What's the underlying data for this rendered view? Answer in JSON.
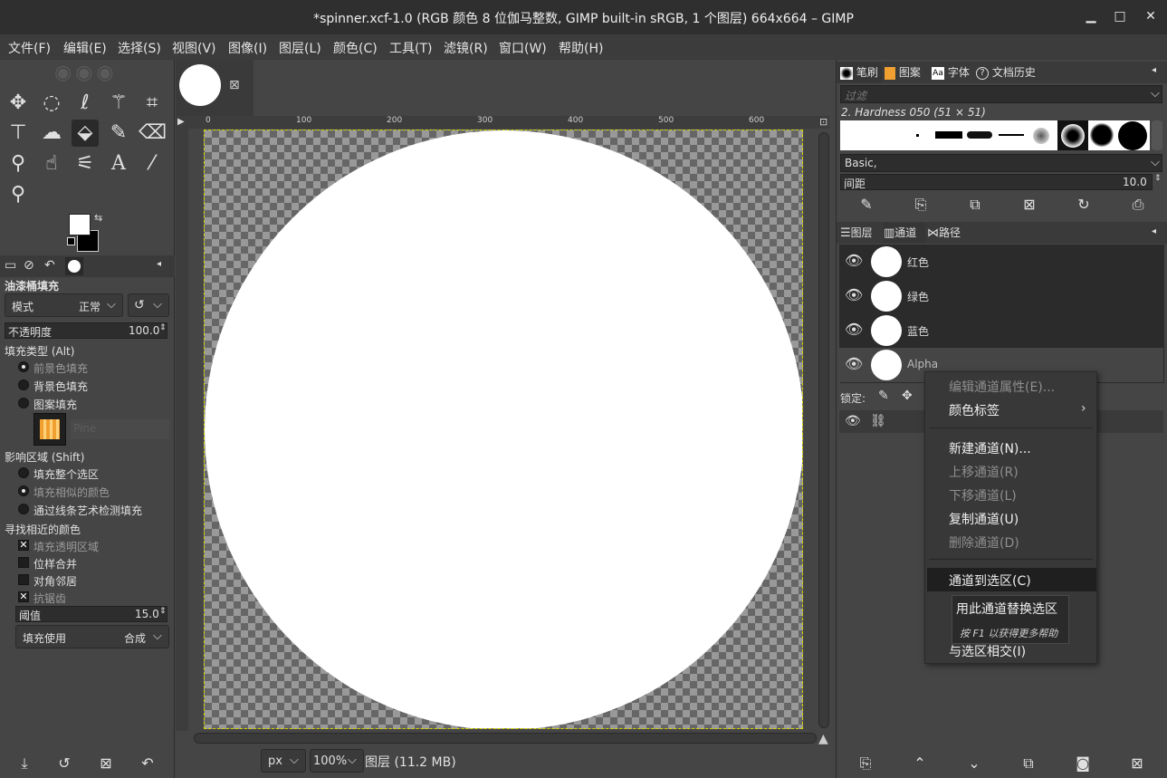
{
  "window": {
    "title": "*spinner.xcf-1.0 (RGB 颜色 8 位伽马整数, GIMP built-in sRGB, 1 个图层) 664x664 – GIMP"
  },
  "menubar": [
    "文件(F)",
    "编辑(E)",
    "选择(S)",
    "视图(V)",
    "图像(I)",
    "图层(L)",
    "颜色(C)",
    "工具(T)",
    "滤镜(R)",
    "窗口(W)",
    "帮助(H)"
  ],
  "tool_options": {
    "title": "油漆桶填充",
    "mode_label": "模式",
    "mode_value": "正常",
    "opacity_label": "不透明度",
    "opacity_value": "100.0",
    "fill_type_label": "填充类型 (Alt)",
    "fill_types": [
      "前景色填充",
      "背景色填充",
      "图案填充"
    ],
    "pattern_name": "Pine",
    "affected_area_label": "影响区域 (Shift)",
    "affected_areas": [
      "填充整个选区",
      "填充相似的颜色",
      "通过线条艺术检测填充"
    ],
    "find_similar_label": "寻找相近的颜色",
    "checks": [
      "填充透明区域",
      "位样合并",
      "对角邻居",
      "抗锯齿"
    ],
    "threshold_label": "阈值",
    "threshold_value": "15.0",
    "fill_by_label": "填充使用",
    "fill_by_value": "合成"
  },
  "canvas": {
    "ruler_ticks": [
      "0",
      "100",
      "200",
      "300",
      "400",
      "500",
      "600"
    ],
    "unit": "px",
    "zoom": "100%",
    "status": "图层 (11.2 MB)"
  },
  "brushes": {
    "tabs": [
      "笔刷",
      "图案",
      "字体",
      "文档历史"
    ],
    "filter_placeholder": "过滤",
    "current": "2. Hardness 050 (51 × 51)",
    "tag": "Basic,",
    "spacing_label": "间距",
    "spacing_value": "10.0"
  },
  "channels": {
    "tabs": [
      "图层",
      "通道",
      "路径"
    ],
    "items": [
      "红色",
      "绿色",
      "蓝色",
      "Alpha"
    ],
    "lock_label": "锁定:"
  },
  "context_menu": {
    "items": [
      {
        "label": "编辑通道属性(E)...",
        "enabled": false
      },
      {
        "label": "颜色标签",
        "enabled": true
      },
      {
        "label": "新建通道(N)...",
        "enabled": true
      },
      {
        "label": "上移通道(R)",
        "enabled": false
      },
      {
        "label": "下移通道(L)",
        "enabled": false
      },
      {
        "label": "复制通道(U)",
        "enabled": true
      },
      {
        "label": "删除通道(D)",
        "enabled": false
      },
      {
        "label": "通道到选区(C)",
        "enabled": true
      },
      {
        "label": "与选区相交(I)",
        "enabled": true
      }
    ]
  },
  "tooltip": {
    "title": "用此通道替换选区",
    "hint": "按 F1 以获得更多帮助"
  }
}
